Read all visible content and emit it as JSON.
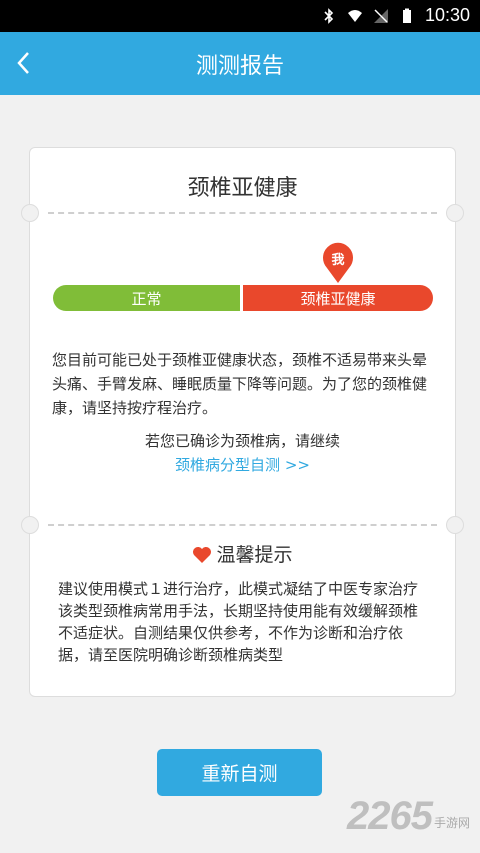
{
  "status_bar": {
    "time": "10:30"
  },
  "app_bar": {
    "title": "测测报告"
  },
  "card": {
    "heading": "颈椎亚健康",
    "bar": {
      "normal_label": "正常",
      "sub_label": "颈椎亚健康",
      "marker_label": "我"
    },
    "description": "您目前可能已处于颈椎亚健康状态，颈椎不适易带来头晕头痛、手臂发麻、睡眠质量下降等问题。为了您的颈椎健康，请坚持按疗程治疗。",
    "confirm_text": "若您已确诊为颈椎病，请继续",
    "link_text": "颈椎病分型自测 >>",
    "tips_title": "温馨提示",
    "tips_text": "建议使用模式１进行治疗，此模式凝结了中医专家治疗该类型颈椎病常用手法，长期坚持使用能有效缓解颈椎不适症状。自测结果仅供参考，不作为诊断和治疗依据，请至医院明确诊断颈椎病类型"
  },
  "retest_button": "重新自测",
  "watermark": {
    "number": "2265",
    "site": "手游网"
  },
  "colors": {
    "accent": "#31a9e0",
    "normal": "#80bd38",
    "sub": "#e9482c"
  }
}
